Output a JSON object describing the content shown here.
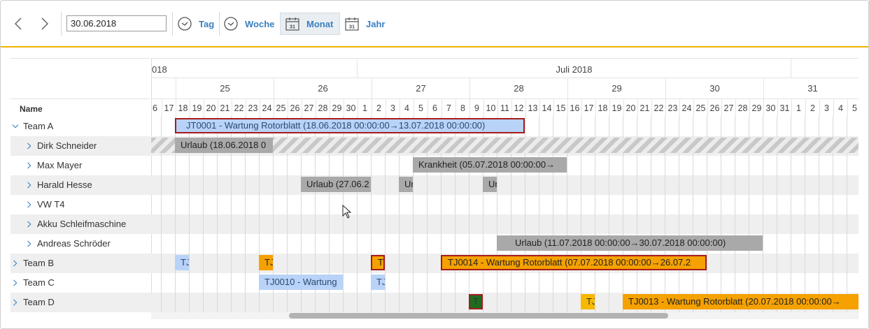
{
  "toolbar": {
    "date_value": "30.06.2018",
    "views": [
      {
        "label": "Tag",
        "icon": "clock-icon"
      },
      {
        "label": "Woche",
        "icon": "clock-icon"
      },
      {
        "label": "Monat",
        "icon": "calendar-icon",
        "calendar_number": "31",
        "active": true
      },
      {
        "label": "Jahr",
        "icon": "calendar-icon",
        "calendar_number": "31"
      }
    ]
  },
  "timeline": {
    "months": [
      "018",
      "Juli 2018"
    ],
    "weeks": [
      "25",
      "26",
      "27",
      "28",
      "29",
      "30",
      "31"
    ],
    "days": [
      "6",
      "17",
      "18",
      "19",
      "20",
      "21",
      "22",
      "23",
      "24",
      "25",
      "26",
      "27",
      "28",
      "29",
      "30",
      "1",
      "2",
      "3",
      "4",
      "5",
      "6",
      "7",
      "8",
      "9",
      "10",
      "11",
      "12",
      "13",
      "14",
      "15",
      "16",
      "17",
      "18",
      "19",
      "20",
      "21",
      "22",
      "23",
      "24",
      "25",
      "26",
      "27",
      "28",
      "29",
      "30",
      "31",
      "1",
      "2",
      "3",
      "4",
      "5"
    ],
    "name_header": "Name"
  },
  "rows": [
    {
      "label": "Team A",
      "expanded": true
    },
    {
      "label": "Dirk Schneider"
    },
    {
      "label": "Max Mayer"
    },
    {
      "label": "Harald Hesse"
    },
    {
      "label": "VW T4"
    },
    {
      "label": "Akku Schleifmaschine"
    },
    {
      "label": "Andreas Schröder"
    },
    {
      "label": "Team B"
    },
    {
      "label": "Team C"
    },
    {
      "label": "Team D"
    }
  ],
  "bars": {
    "jt0001": "JT0001 - Wartung Rotorblatt (18.06.2018 00:00:00→13.07.2018 00:00:00)",
    "urlaub_dirk": "Urlaub (18.06.2018 0",
    "krankheit_max": "Krankheit (05.07.2018 00:00:00→",
    "urlaub_harald_1": "Urlaub (27.06.2",
    "urlaub_harald_2": "Ur",
    "urlaub_harald_3": "Ur",
    "urlaub_andreas": "Urlaub (11.07.2018 00:00:00→30.07.2018 00:00:00)",
    "teamb_1": "TJ",
    "teamb_2": "TJ",
    "teamb_3": "T",
    "teamb_4": "TJ0014 - Wartung Rotorblatt (07.07.2018 00:00:00→26.07.2",
    "teamc_1": "TJ0010 - Wartung",
    "teamc_2": "TJ",
    "teamd_1": "T",
    "teamd_2": "TJ",
    "teamd_3": "TJ0013 - Wartung Rotorblatt (20.07.2018 00:00:00→"
  },
  "colors": {
    "accent": "#f0b400",
    "link": "#3a7fbf",
    "bar_blue": "#b8d3f7",
    "bar_gray": "#a9a9a9",
    "bar_orange": "#f5a100",
    "selection_border": "#a51c1c",
    "bar_green": "#1f6b1f"
  }
}
